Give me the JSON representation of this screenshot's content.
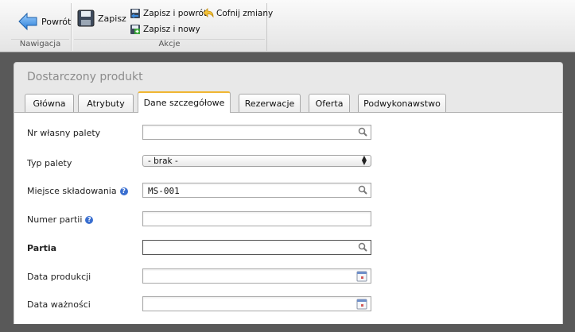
{
  "toolbar": {
    "nav_group_label": "Nawigacja",
    "actions_group_label": "Akcje",
    "back_label": "Powrót",
    "save_label": "Zapisz",
    "save_back_label": "Zapisz i powrót",
    "save_new_label": "Zapisz i nowy",
    "undo_label": "Cofnij zmiany"
  },
  "window": {
    "title": "Dostarczony produkt"
  },
  "tabs": [
    {
      "label": "Główna",
      "active": false
    },
    {
      "label": "Atrybuty",
      "active": false
    },
    {
      "label": "Dane szczegółowe",
      "active": true
    },
    {
      "label": "Rezerwacje",
      "active": false
    },
    {
      "label": "Oferta",
      "active": false
    },
    {
      "label": "Podwykonawstwo",
      "active": false
    }
  ],
  "form": {
    "pallet_own_no": {
      "label": "Nr własny palety",
      "value": "",
      "icon": "search-icon"
    },
    "pallet_type": {
      "label": "Typ palety",
      "value": "- brak -"
    },
    "storage_location": {
      "label": "Miejsce składowania",
      "value": "MS-001",
      "icon": "search-icon",
      "help": "?"
    },
    "batch_number": {
      "label": "Numer partii",
      "value": "",
      "help": "?"
    },
    "batch": {
      "label": "Partia",
      "value": "",
      "icon": "search-icon"
    },
    "production_date": {
      "label": "Data produkcji",
      "value": "",
      "icon": "calendar-icon"
    },
    "expiry_date": {
      "label": "Data ważności",
      "value": "",
      "icon": "calendar-icon"
    }
  },
  "colors": {
    "active_tab_accent": "#f0b632",
    "help_icon": "#3a6fd0",
    "background": "#595959"
  }
}
